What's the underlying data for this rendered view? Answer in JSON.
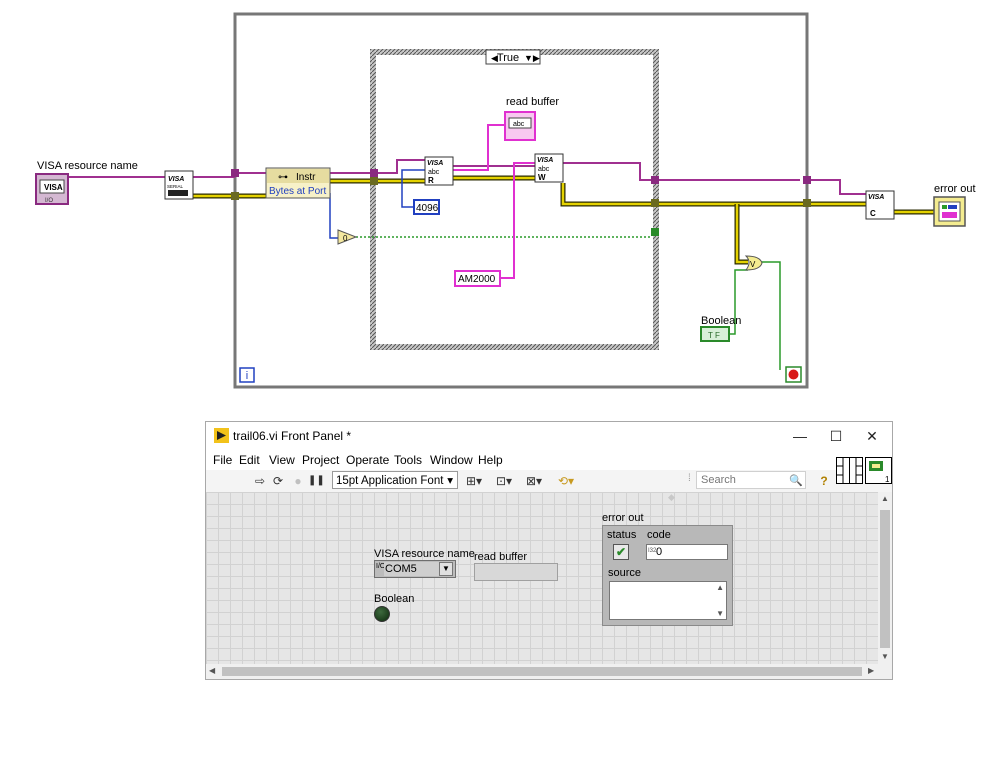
{
  "block_diagram": {
    "case_selector": "True",
    "labels": {
      "visa_resource_name": "VISA resource name",
      "read_buffer": "read buffer",
      "error_out": "error out",
      "boolean": "Boolean"
    },
    "property_node": {
      "class": "Instr",
      "property": "Bytes at Port"
    },
    "constants": {
      "byte_count": "4096",
      "write_string": "AM2000",
      "zero": "0"
    },
    "icons": {
      "visa_small": "VISA",
      "visa_serial": "VISA",
      "serial": "SERIAL",
      "abc": "abc",
      "read_letter": "R",
      "write_letter": "W",
      "close_letter": "C",
      "io": "I/O",
      "tf": "T F",
      "or_letter": "V",
      "info": "i"
    }
  },
  "front_panel": {
    "window_title": "trail06.vi Front Panel *",
    "window_buttons": {
      "minimize": "—",
      "maximize": "☐",
      "close": "✕"
    },
    "menu": [
      "File",
      "Edit",
      "View",
      "Project",
      "Operate",
      "Tools",
      "Window",
      "Help"
    ],
    "toolbar": {
      "run": "⇨",
      "run_continuous": "⟳",
      "abort": "●",
      "pause": "❚❚",
      "font": "15pt Application Font",
      "font_arrow": "▾",
      "align": "⊞▾",
      "distribute": "⊡▾",
      "resize": "⊠▾",
      "reorder": "⟲▾",
      "search_placeholder": "Search",
      "search_icon": "🔍",
      "help_icon": "?"
    },
    "controls": {
      "visa_label": "VISA resource name",
      "visa_value": "COM5",
      "visa_prefix": "I/O",
      "read_buffer_label": "read buffer",
      "boolean_label": "Boolean",
      "error_out": {
        "label": "error out",
        "status_label": "status",
        "code_label": "code",
        "code_value": "0",
        "source_label": "source",
        "code_prefix": "I32"
      }
    },
    "connector_index": "1"
  }
}
